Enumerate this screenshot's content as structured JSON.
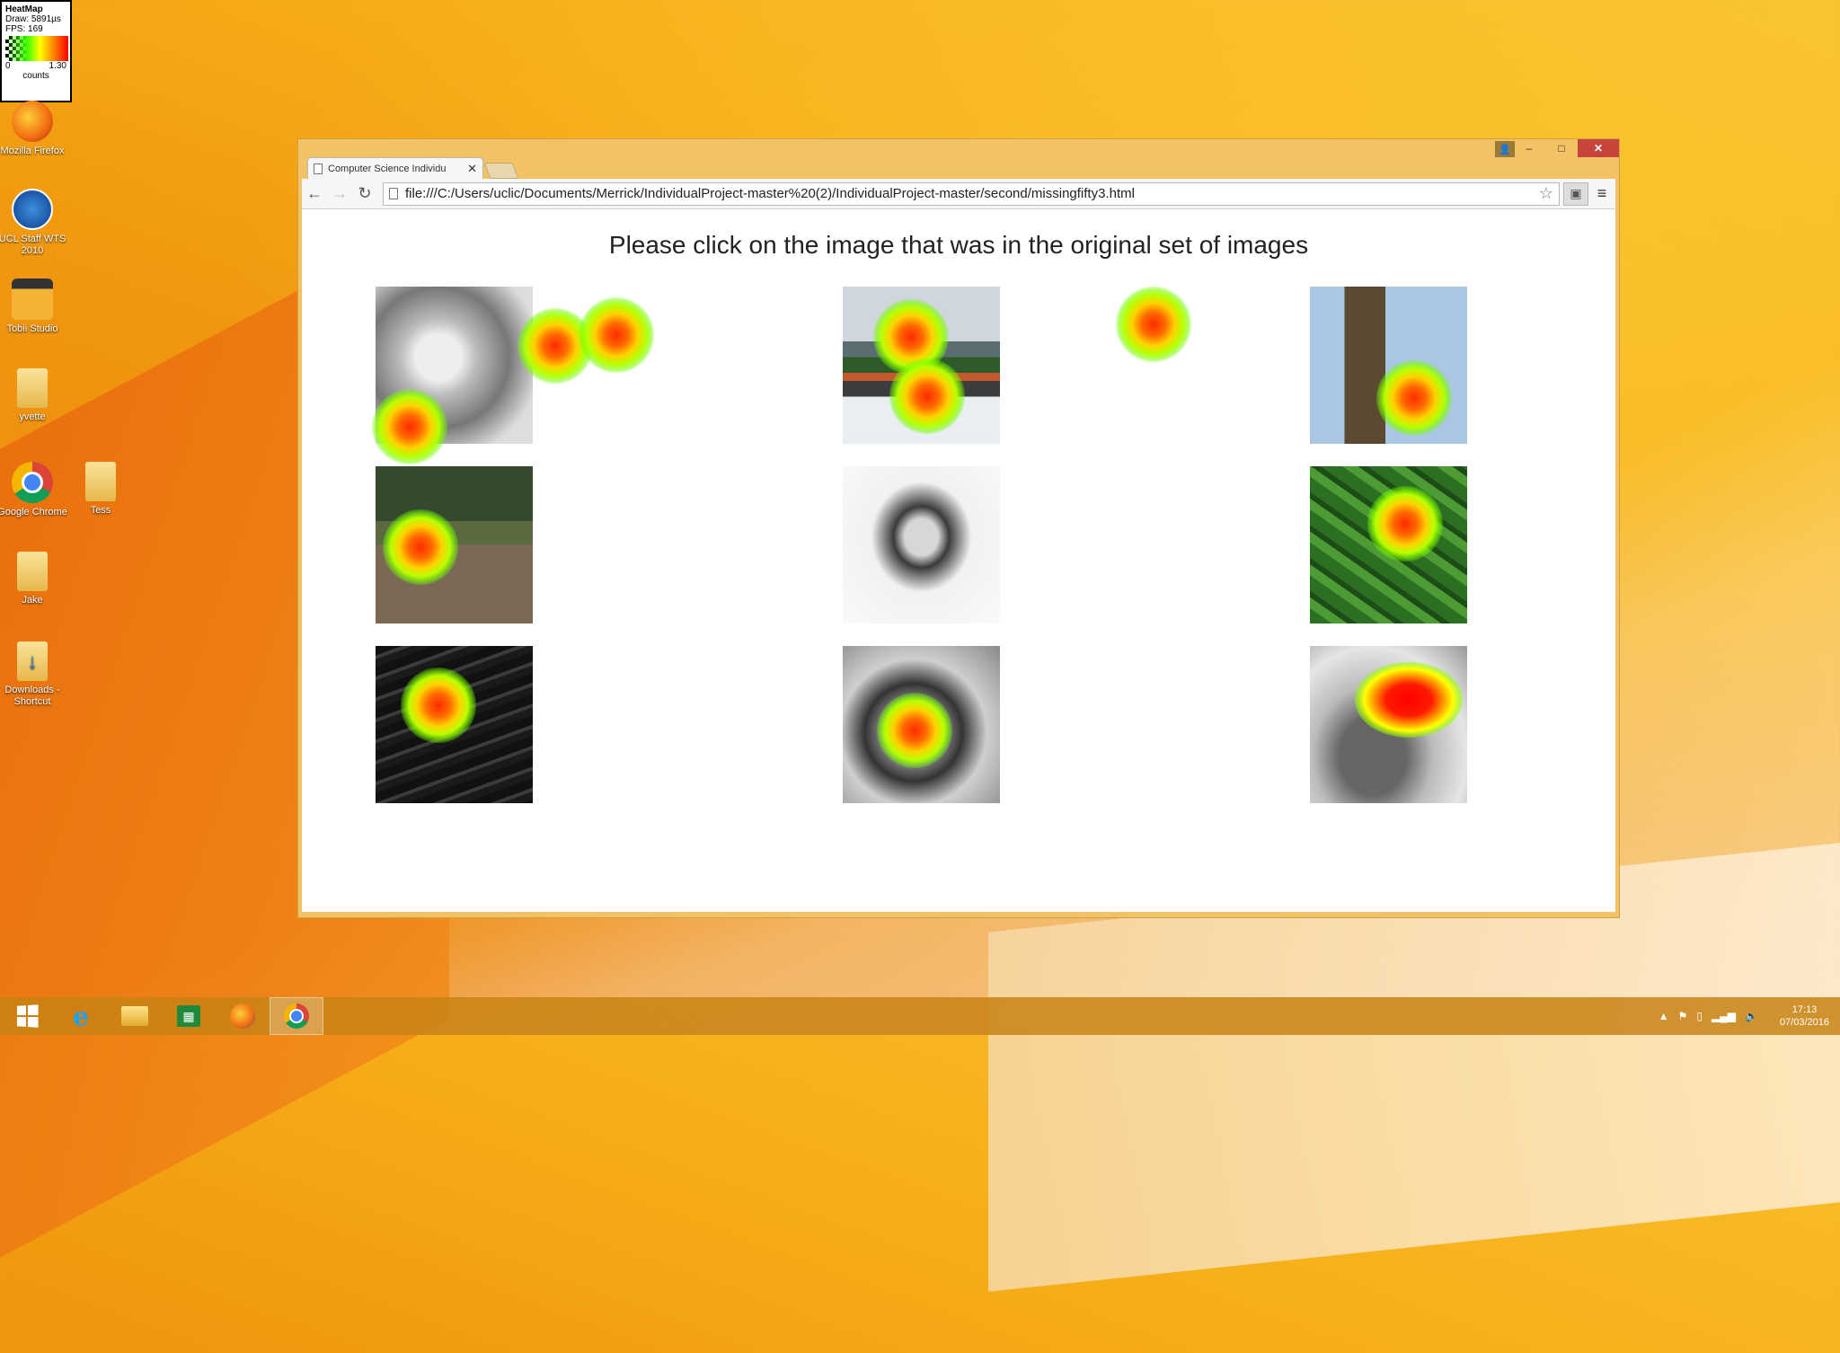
{
  "heatmap_legend": {
    "title": "HeatMap",
    "draw": "Draw: 5891µs",
    "fps": "FPS: 169",
    "scale_min": "0",
    "scale_max": "1.30",
    "units": "counts"
  },
  "desktop_icons": [
    {
      "name": "firefox",
      "label": "Mozilla Firefox",
      "icon": "firefox-icon"
    },
    {
      "name": "ucl-staff",
      "label": "UCL Staff WTS 2010",
      "icon": "remote-desktop-icon"
    },
    {
      "name": "tobii-studio",
      "label": "Tobii Studio",
      "icon": "tobii-icon"
    },
    {
      "name": "yvette",
      "label": "yvette",
      "icon": "folder-icon"
    },
    {
      "name": "google-chrome",
      "label": "Google Chrome",
      "icon": "chrome-icon"
    },
    {
      "name": "tess",
      "label": "Tess",
      "icon": "folder-icon"
    },
    {
      "name": "jake",
      "label": "Jake",
      "icon": "folder-icon"
    },
    {
      "name": "downloads",
      "label": "Downloads - Shortcut",
      "icon": "folder-icon"
    }
  ],
  "browser": {
    "tab_title": "Computer Science Individu",
    "url": "file:///C:/Users/uclic/Documents/Merrick/IndividualProject-master%20(2)/IndividualProject-master/second/missingfifty3.html",
    "window_controls": {
      "minimize": "–",
      "maximize": "□",
      "close": "✕"
    },
    "nav": {
      "back": "←",
      "forward": "→",
      "reload": "↻",
      "star": "☆",
      "menu": "≡"
    }
  },
  "page": {
    "heading": "Please click on the image that was in the original set of images",
    "images": [
      {
        "subject": "sleeping-baby"
      },
      {
        "subject": "train-in-snow"
      },
      {
        "subject": "clock-tower"
      },
      {
        "subject": "forest-path"
      },
      {
        "subject": "woman-in-fur-hood"
      },
      {
        "subject": "cucumbers"
      },
      {
        "subject": "keyboard"
      },
      {
        "subject": "feet-on-plate"
      },
      {
        "subject": "parrot"
      }
    ]
  },
  "taskbar": {
    "items": [
      "start",
      "internet-explorer",
      "file-explorer",
      "store",
      "firefox",
      "chrome"
    ],
    "active": "chrome",
    "clock_time": "17:13",
    "clock_date": "07/03/2016",
    "tray_chevron": "▲"
  },
  "colors": {
    "desktop": "#f6ae17",
    "window_frame": "#f2c265",
    "close_button": "#c7443a",
    "taskbar": "#c8821a"
  }
}
